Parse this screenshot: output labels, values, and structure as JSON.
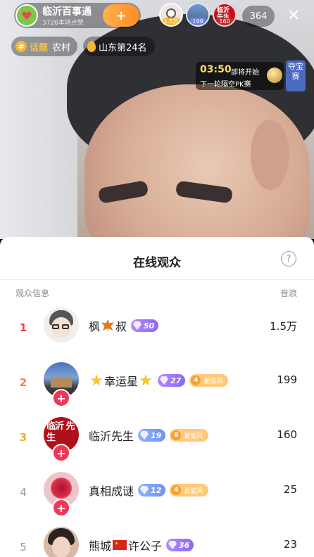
{
  "header": {
    "anchor_badge": "临沂百事通",
    "anchor_name": "临沂百事通",
    "likes_text": "3726本场点赞",
    "follow_symbol": "+",
    "viewer_avatars": [
      {
        "tag": "1.5万"
      },
      {
        "tag": "199"
      },
      {
        "tag": "160",
        "stamp": "临沂 先生"
      }
    ],
    "viewer_count": "364",
    "close_symbol": "✕"
  },
  "chips": {
    "topic_hash": "#",
    "topic_label": "话题",
    "topic_value": "农村",
    "rank_text": "山东第24名"
  },
  "pk": {
    "time": "03:50",
    "start_text": "即将开始",
    "next_text": "下一轮隔空PK赛",
    "treasure_label": "夺宝赛"
  },
  "sheet": {
    "title": "在线观众",
    "help_symbol": "?",
    "col_left": "观众信息",
    "col_right": "音浪",
    "rows": [
      {
        "rank": "1",
        "name_a": "枫",
        "name_b": "叔",
        "level": "50",
        "score": "1.5万"
      },
      {
        "rank": "2",
        "name": "幸运星",
        "level": "27",
        "fan_num": "4",
        "fan_text": "更旋风",
        "score": "199"
      },
      {
        "rank": "3",
        "name": "临沂先生",
        "level": "19",
        "fan_num": "8",
        "fan_text": "更旋风",
        "score": "160",
        "avatar_text": "临沂 先生"
      },
      {
        "rank": "4",
        "name": "真相成谜",
        "level": "12",
        "fan_num": "4",
        "fan_text": "更旋风",
        "score": "25"
      },
      {
        "rank": "5",
        "name_a": "熊城",
        "name_b": "许公子",
        "level": "36",
        "score": "23"
      }
    ],
    "follow_symbol": "+"
  },
  "colors": {
    "rank1": "#e8473c",
    "rank2": "#f5813a",
    "rank3": "#f3a939",
    "follow_plus": "#f0375a",
    "level_purple": "#8d67f0",
    "level_blue": "#6f92f0"
  },
  "icons": [
    "heart-badge-icon",
    "plus-icon",
    "close-icon",
    "hash-icon",
    "fire-icon",
    "help-icon",
    "maple-leaf-icon",
    "star-icon",
    "china-flag-icon",
    "gem-icon"
  ]
}
